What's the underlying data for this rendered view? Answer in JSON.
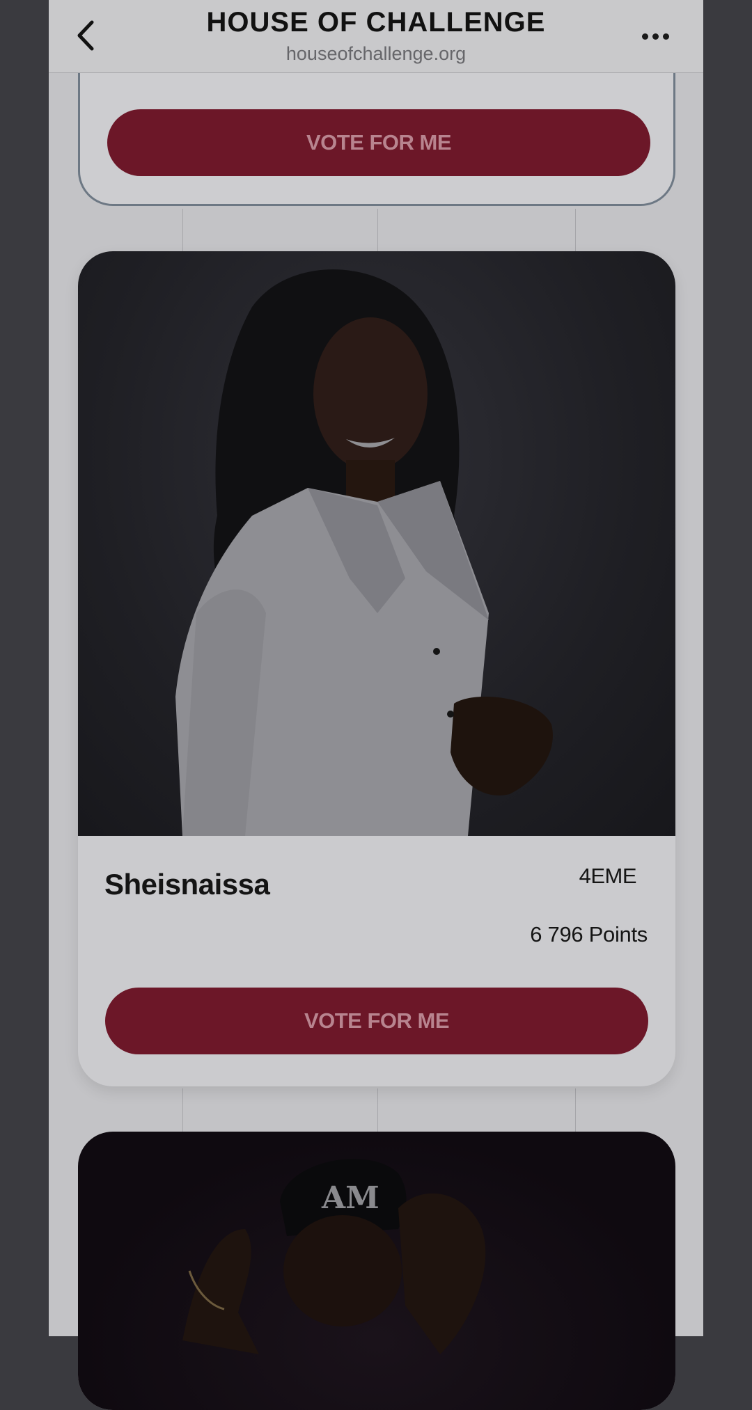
{
  "header": {
    "title": "HOUSE OF CHALLENGE",
    "url": "houseofchallenge.org"
  },
  "cards": [
    {
      "vote_label": "VOTE FOR ME"
    },
    {
      "name": "Sheisnaissa",
      "rank": "4EME",
      "points": "6 796 Points",
      "vote_label": "VOTE FOR ME"
    },
    {
      "cap_logo": "AM"
    }
  ],
  "colors": {
    "vote_button": "#6c1728",
    "vote_text": "#b8848f",
    "overlay_background": "#3a3a3f"
  },
  "icons": {
    "back": "chevron-left-icon",
    "more": "more-horizontal-icon"
  }
}
